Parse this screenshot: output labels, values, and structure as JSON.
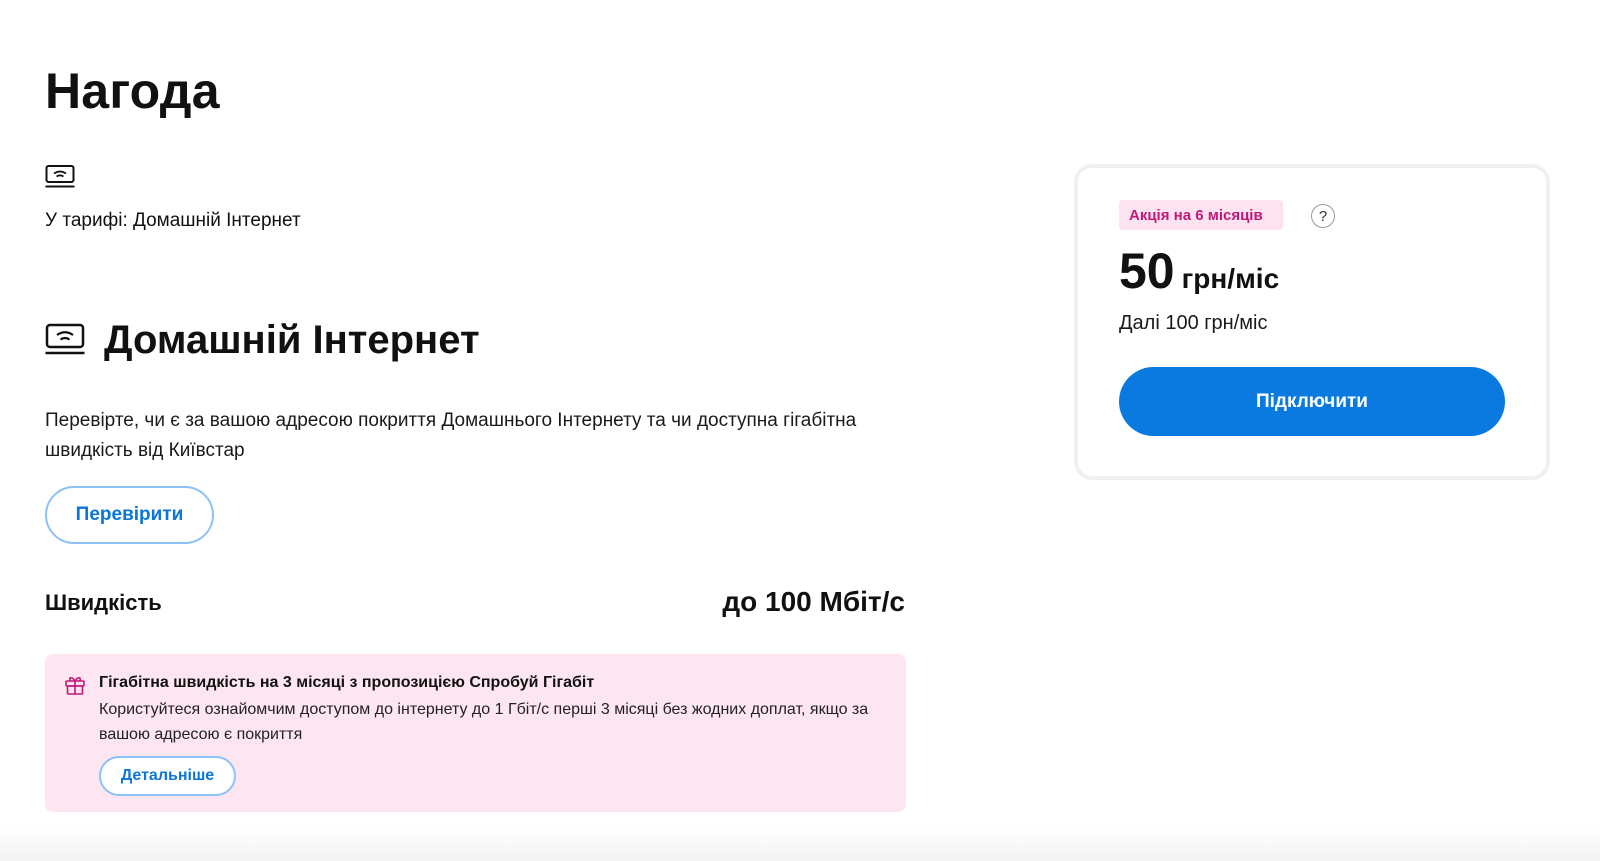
{
  "page": {
    "title": "Нагода"
  },
  "tariff": {
    "label": "У тарифі: Домашній Інтернет",
    "icon": "router-icon"
  },
  "section": {
    "title": "Домашній Інтернет",
    "icon": "router-icon",
    "description": "Перевірте, чи є за вашою адресою покриття Домашнього Інтернету та чи доступна гігабітна швидкість від Київстар",
    "check_button": "Перевірити"
  },
  "speed": {
    "label": "Швидкість",
    "value": "до 100 Мбіт/с"
  },
  "promo": {
    "icon": "gift-icon",
    "title": "Гігабітна швидкість на 3 місяці з пропозицією Спробуй Гігабіт",
    "text": "Користуйтеся ознайомчим доступом до інтернету до 1 Гбіт/с перші 3 місяці без жодних доплат, якщо за вашою адресою є покриття",
    "details_button": "Детальніше"
  },
  "price_card": {
    "badge": "Акція на 6 місяців",
    "help": "?",
    "amount": "50",
    "unit": "грн/міс",
    "after": "Далі 100 грн/міс",
    "connect_button": "Підключити"
  },
  "colors": {
    "accent": "#0a7ae0",
    "promo_bg": "#fde6f1",
    "badge_text": "#c2187a",
    "button_border": "#8cc1f5"
  }
}
